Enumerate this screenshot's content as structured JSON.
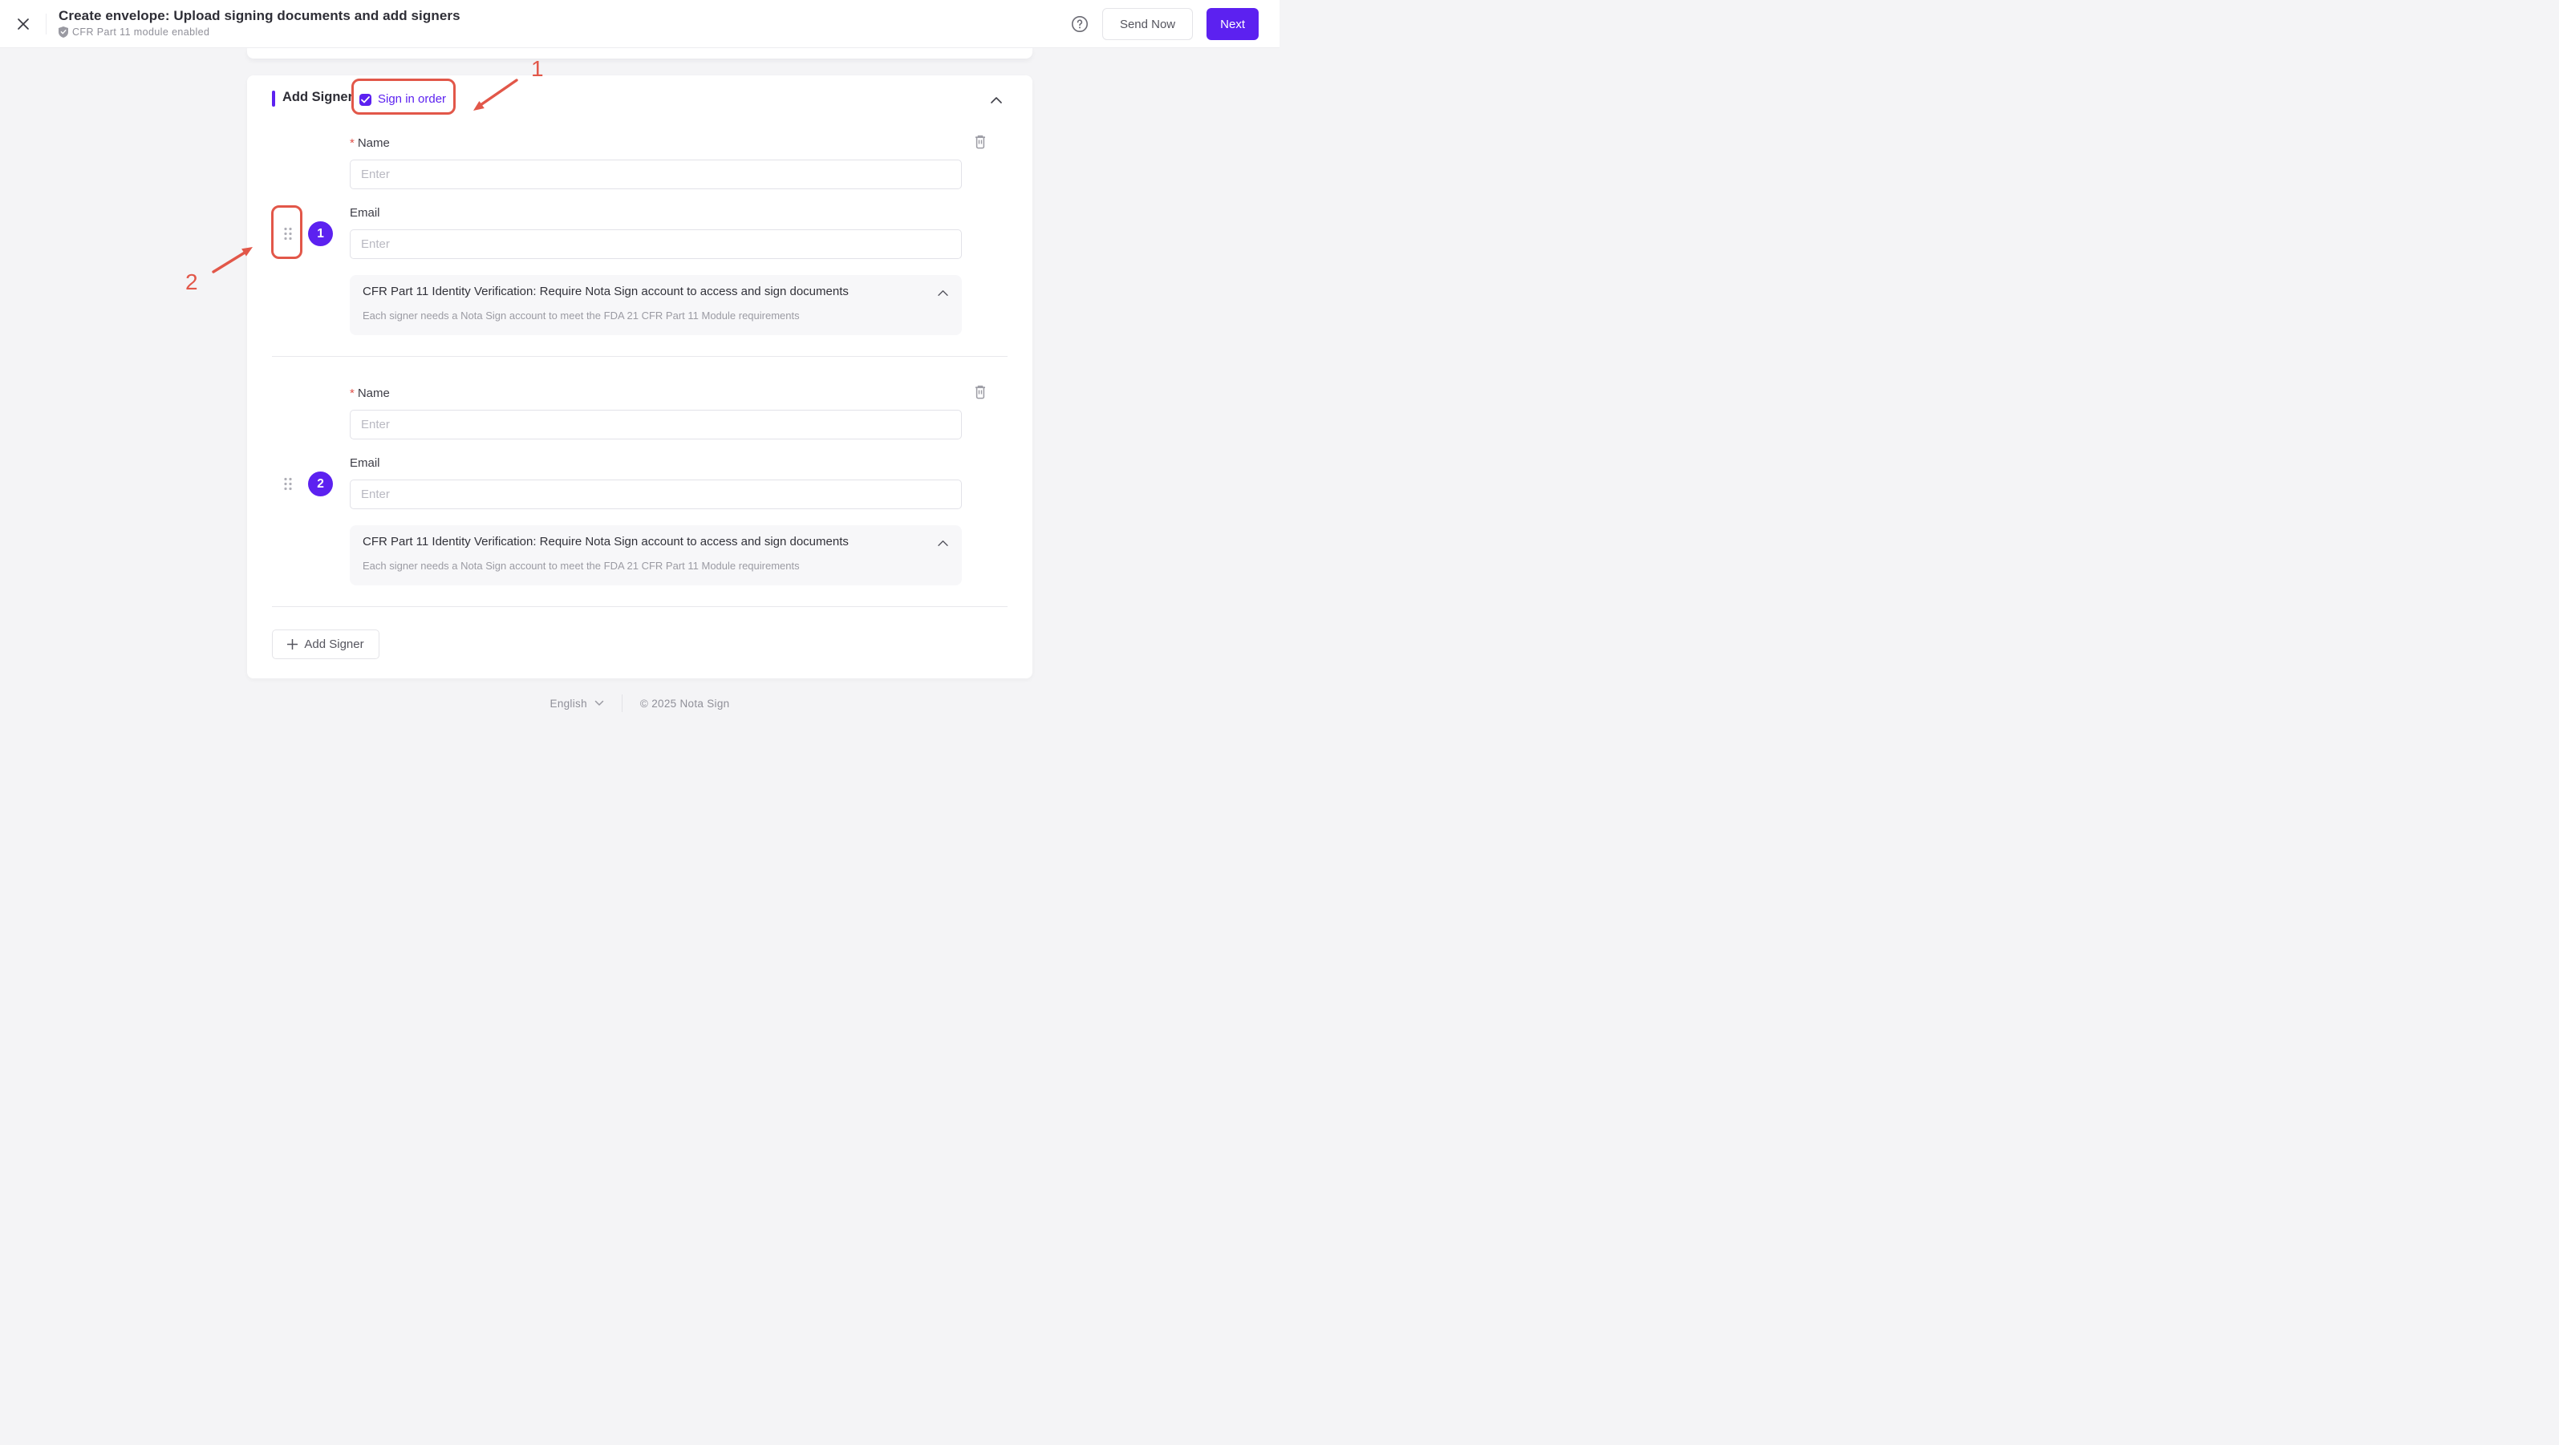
{
  "header": {
    "title": "Create envelope: Upload signing documents and add signers",
    "subtitle": "CFR Part 11 module enabled",
    "send_now": "Send Now",
    "next": "Next"
  },
  "section": {
    "title": "Add Signer",
    "sign_in_order": "Sign in order",
    "sign_in_order_checked": true
  },
  "signers": [
    {
      "order": "1",
      "required_mark": "*",
      "name_label": "Name",
      "name_placeholder": "Enter",
      "name_value": "",
      "email_label": "Email",
      "email_placeholder": "Enter",
      "email_value": "",
      "cfr_title": "CFR Part 11 Identity Verification: Require Nota Sign account to access and sign documents",
      "cfr_desc": "Each signer needs a Nota Sign account to meet the FDA 21 CFR Part 11 Module requirements"
    },
    {
      "order": "2",
      "required_mark": "*",
      "name_label": "Name",
      "name_placeholder": "Enter",
      "name_value": "",
      "email_label": "Email",
      "email_placeholder": "Enter",
      "email_value": "",
      "cfr_title": "CFR Part 11 Identity Verification: Require Nota Sign account to access and sign documents",
      "cfr_desc": "Each signer needs a Nota Sign account to meet the FDA 21 CFR Part 11 Module requirements"
    }
  ],
  "add_signer_label": "Add Signer",
  "annotations": {
    "step_one": "1",
    "step_two": "2"
  },
  "footer": {
    "language": "English",
    "copyright": "© 2025 Nota Sign"
  },
  "colors": {
    "accent": "#5c21f0",
    "annotation_red": "#e25749"
  }
}
